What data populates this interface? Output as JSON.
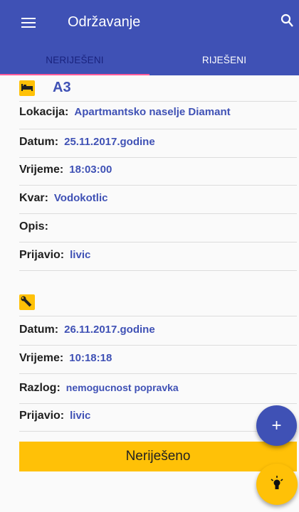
{
  "appbar": {
    "title": "Održavanje",
    "menu_icon": "menu-icon",
    "search_icon": "search-icon",
    "color": "#3f51b5"
  },
  "tabs": [
    {
      "label": "NERIJEŠENI",
      "active": true
    },
    {
      "label": "RIJEŠENI",
      "active": false
    }
  ],
  "report": {
    "unit_icon": "bed-icon",
    "unit": "A3",
    "fields": [
      {
        "label": "Lokacija:",
        "value": "Apartmantsko naselje Diamant"
      },
      {
        "label": "Datum:",
        "value": "25.11.2017.godine"
      },
      {
        "label": "Vrijeme:",
        "value": "18:03:00"
      },
      {
        "label": "Kvar:",
        "value": "Vodokotlic"
      },
      {
        "label": "Opis:",
        "value": ""
      },
      {
        "label": "Prijavio:",
        "value": "livic"
      }
    ]
  },
  "repair": {
    "icon": "wrench-icon",
    "fields": [
      {
        "label": "Datum:",
        "value": "26.11.2017.godine"
      },
      {
        "label": "Vrijeme:",
        "value": "10:18:18"
      },
      {
        "label": "Razlog:",
        "value": "nemogucnost popravka"
      },
      {
        "label": "Prijavio:",
        "value": "livic"
      }
    ]
  },
  "status_button": "Neriješeno",
  "fab_add": {
    "label": "+",
    "icon": "plus-icon"
  },
  "fab_light": {
    "icon": "lightbulb-icon"
  },
  "colors": {
    "primary": "#3f51b5",
    "accent": "#ffc107",
    "indicator": "#ff5c9a"
  }
}
